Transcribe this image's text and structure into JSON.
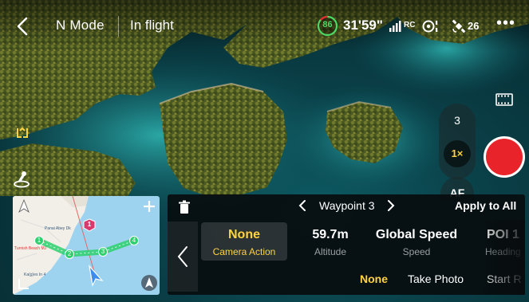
{
  "header": {
    "mode": "N Mode",
    "status": "In flight",
    "battery": "86",
    "flight_time": "31'59\"",
    "rc_label": "RC",
    "satellites": "26",
    "more_label": "•••"
  },
  "camera": {
    "zoom_3": "3",
    "zoom_1": "1×",
    "af": "AF"
  },
  "map": {
    "labels": [
      "Panai Abey Dk",
      "Turnish Beach MJ",
      "Ka(g)es In 4"
    ],
    "poi_number": "1",
    "waypoints": [
      "1",
      "2",
      "3",
      "4"
    ]
  },
  "panel": {
    "waypoint_title": "Waypoint 3",
    "apply_all": "Apply to All",
    "params": [
      {
        "value": "None",
        "label": "Camera Action"
      },
      {
        "value": "59.7m",
        "label": "Altitude"
      },
      {
        "value": "Global Speed",
        "label": "Speed"
      },
      {
        "value": "POI 1",
        "label": "Heading"
      }
    ],
    "options": [
      "None",
      "Take Photo",
      "Start R"
    ]
  },
  "colors": {
    "accent": "#ffd33d",
    "record": "#e8242a",
    "route": "#2ed06e",
    "battery": "#4cd964"
  }
}
